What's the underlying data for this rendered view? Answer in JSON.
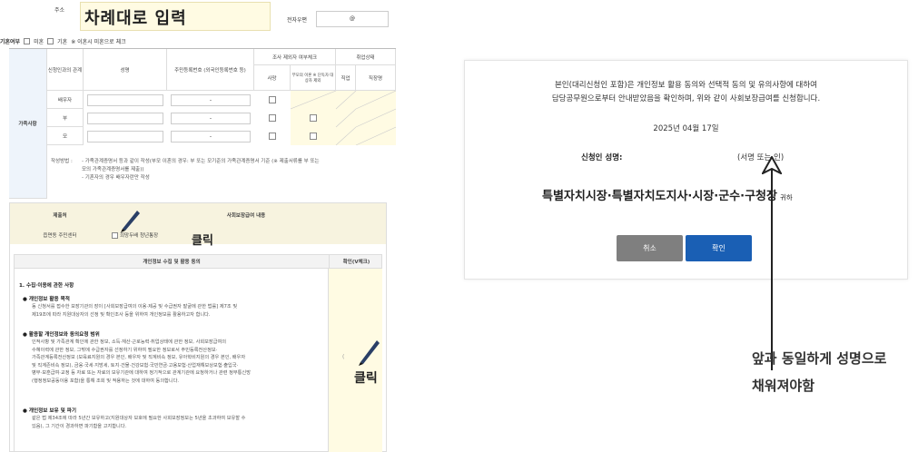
{
  "panelA": {
    "address_label": "주소",
    "address_overlay": "차례대로 입력",
    "phone_label": "전자우편",
    "phone_value": "@",
    "marital": {
      "label": "기혼여부",
      "opt_unmarried": "미혼",
      "opt_married": "기혼",
      "note": "※ 이혼시 미혼으로 체크"
    },
    "side_label": "가족사항",
    "headers": {
      "relation": "신청인과의 관계",
      "name": "성명",
      "rrn": "주민등록번호 (외국인등록번호 등)",
      "survey": "조사 제외자 여부체크",
      "survey_a": "사망",
      "survey_b": "부모의 이혼 ※ 단독자 대상자 제외",
      "job": "취업상태",
      "job_a": "직업",
      "job_b": "직장명"
    },
    "rows": [
      {
        "relation": "배우자",
        "rrn": "-"
      },
      {
        "relation": "부",
        "rrn": "-"
      },
      {
        "relation": "모",
        "rrn": "-"
      }
    ],
    "note_label": "작성방법 :",
    "notes": [
      "- 가족관계증명서 등과 같이 작성(부모 이혼의 경우: 부 또는 모기준의 가족관계증명서 기준 (※ 제출서류를 부 또는",
      "  모의 가족관계증명서를 제출))",
      "- 기혼자의 경우 배우자란만 작성"
    ]
  },
  "panelB": {
    "col_submitter": "제출처",
    "col_benefit": "사회보장급여 내용",
    "submitter_value": "읍면동 주민센터",
    "benefit_value": "희망두배 청년통장",
    "click1": "클릭",
    "consent_title": "개인정보 수집 및 활용 동의",
    "confirm_header": "확인(V체크)",
    "section1": "1. 수집·이용에 관한 사항",
    "bullet1": "● 개인정보 활용 목적",
    "bullet1_text": [
      "동 신청서를 접수한 보장기관의 장이 [사회보장급여의 이용·제공 및 수급권자 발굴에 관한 법률] 제7조 및",
      "제19조에 따라 지원대상자의 선정 및 확인조사 등을 위하여 개인정보를 활용하고자 합니다."
    ],
    "bullet2": "● 활용할 개인정보와 동의요청 범위",
    "bullet2_text": [
      "인적사항 및 가족관계 확인에 관한 정보, 소득·재산·근로능력·취업상태에 관한 정보, 사회보장급여의",
      "수혜이력에 관한 정보, 그밖에 수급권자를 선정하기 위하여 필요한 정보로서 주민등록전산정보·",
      "가족관계등록전산정보 (보육료지원의 경우 본인, 배우자 및 직계비속 정보, 유아학비지원의 경우 본인, 배우자",
      "및 직계존비속 정보), 금융·국세·지방세, 토지·건물·건강보험·국민연금·고용보험·산업재해보상보험·출입국·",
      "병무·보훈급여·교정 등 자료 또는 자료의 보유기관에 대하여 정기적으로 관계기관에 요청하거나 관련 정부통신망",
      "(행정정보공동이용 포함)을 통해 조회 및 적용하는 것에 대하여 동의합니다."
    ],
    "bullet3": "● 개인정보 보유 및 파기",
    "bullet3_text": [
      "같은 법 제34조에 따라 5년간 보유하고(지원대상자 보호에 필요한 사회보장정보는 5년을 초과하여 보유할 수",
      "있음), 그 기간이 경과하면 파기함을 고지합니다."
    ],
    "click2": "클릭"
  },
  "dialog": {
    "line1": "본인(대리신청인 포함)은 개인정보 활용 동의와 선택적 동의 및 유의사항에 대하여",
    "line2": "담당공무원으로부터 안내받았음을 확인하며, 위와 같이 사회보장급여를 신청합니다.",
    "date": "2025년 04월 17일",
    "signer_label": "신청인 성명:",
    "signer_value": "(서명 또는 인)",
    "office": "특별자치시장·특별자치도지사·시장·군수·구청장",
    "office_suffix": "귀하",
    "cancel_label": "취소",
    "ok_label": "확인"
  },
  "annotation": {
    "line1": "앞과 동일하게 성명으로",
    "line2": "채워져야함"
  }
}
